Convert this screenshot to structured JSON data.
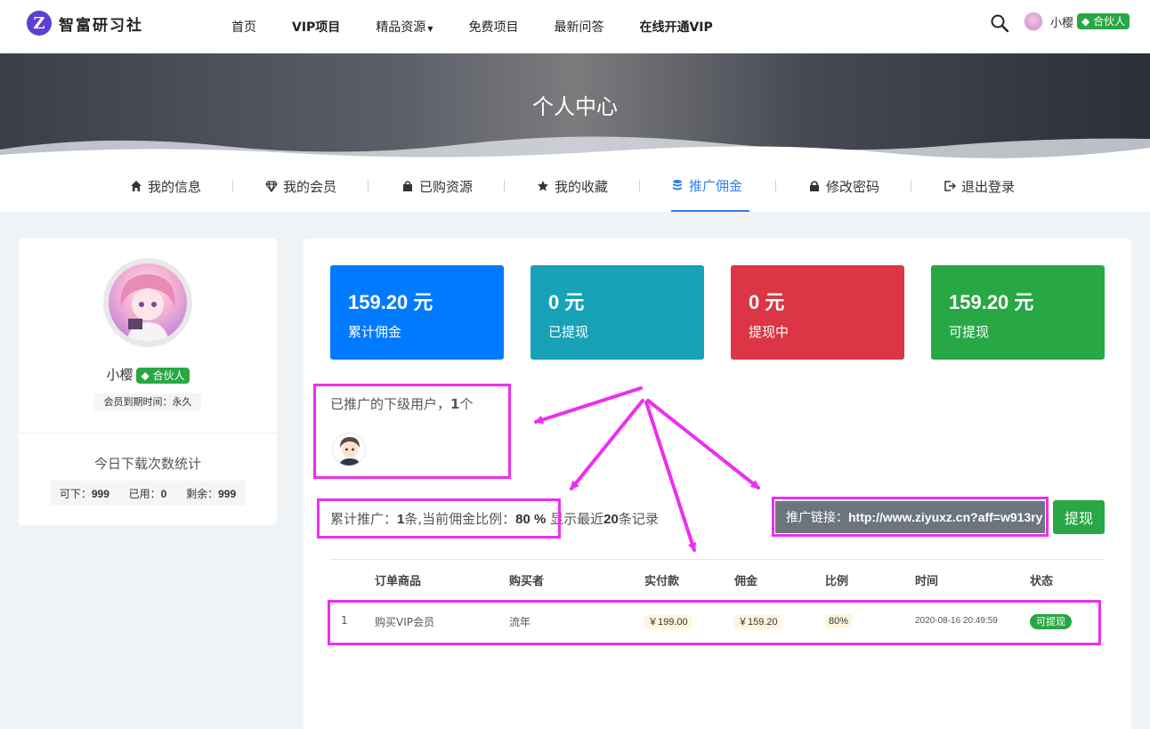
{
  "brand": {
    "logo_letter": "Z",
    "name": "智富研习社"
  },
  "nav": {
    "items": [
      "首页",
      "VIP项目",
      "精品资源",
      "免费项目",
      "最新问答",
      "在线开通VIP"
    ]
  },
  "header_user": {
    "name": "小樱",
    "badge": "合伙人"
  },
  "banner": {
    "title": "个人中心"
  },
  "tabs": [
    "我的信息",
    "我的会员",
    "已购资源",
    "我的收藏",
    "推广佣金",
    "修改密码",
    "退出登录"
  ],
  "active_tab": "推广佣金",
  "sidebar": {
    "name": "小樱",
    "badge": "合伙人",
    "expire": "会员到期时间：永久",
    "stat_title": "今日下载次数统计",
    "stat": {
      "can_label": "可下：",
      "can": "999",
      "used_label": "已用：",
      "used": "0",
      "left_label": "剩余：",
      "left": "999"
    }
  },
  "cards": [
    {
      "value": "159.20",
      "unit": "元",
      "label": "累计佣金",
      "color": "#007bff"
    },
    {
      "value": "0",
      "unit": "元",
      "label": "已提现",
      "color": "#17a2b8"
    },
    {
      "value": "0",
      "unit": "元",
      "label": "提现中",
      "color": "#dc3545"
    },
    {
      "value": "159.20",
      "unit": "元",
      "label": "可提现",
      "color": "#28a745"
    }
  ],
  "referrals": {
    "prefix": "已推广的下级用户，",
    "count": "1",
    "suffix": "个"
  },
  "summary": {
    "p1": "累计推广：",
    "count": "1",
    "p2": "条,当前佣金比例：",
    "ratio": "80 %",
    "p3": "显示最近",
    "recent": "20",
    "p4": "条记录"
  },
  "promo": {
    "label": "推广链接：",
    "url": "http://www.ziyuxz.cn?aff=w913ry",
    "withdraw_button": "提现"
  },
  "table": {
    "headers": [
      "订单商品",
      "购买者",
      "实付款",
      "佣金",
      "比例",
      "时间",
      "状态"
    ],
    "rows": [
      {
        "no": "1",
        "product": "购买VIP会员",
        "buyer": "流年",
        "paid": "￥199.00",
        "commission": "￥159.20",
        "ratio": "80%",
        "time": "2020-08-16 20:49:59",
        "status": "可提现"
      }
    ]
  },
  "colors": {
    "accent": "#2f80ed",
    "highlight": "#ee2ef0",
    "success": "#28a745"
  }
}
